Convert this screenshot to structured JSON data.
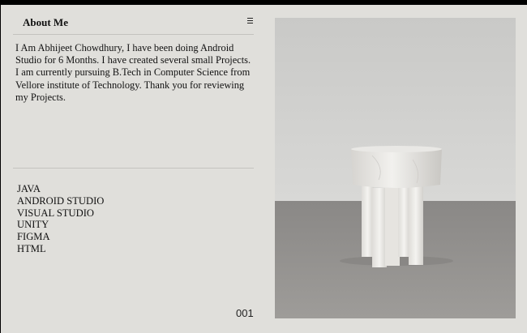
{
  "panel": {
    "title": "About Me",
    "menu_icon": "hamburger-menu-icon",
    "bio": "I Am Abhijeet Chowdhury, I have been doing Android Studio for 6 Months. I have created several small Projects. I am currently pursuing B.Tech in Computer Science from Vellore institute of Technology. Thank you for reviewing my Projects.",
    "skills": [
      "JAVA",
      "ANDROID STUDIO",
      "VISUAL STUDIO",
      "UNITY",
      "FIGMA",
      "HTML"
    ],
    "page_number": "001"
  },
  "colors": {
    "background": "#e0dfdb",
    "text": "#111111",
    "outer": "#000000"
  }
}
